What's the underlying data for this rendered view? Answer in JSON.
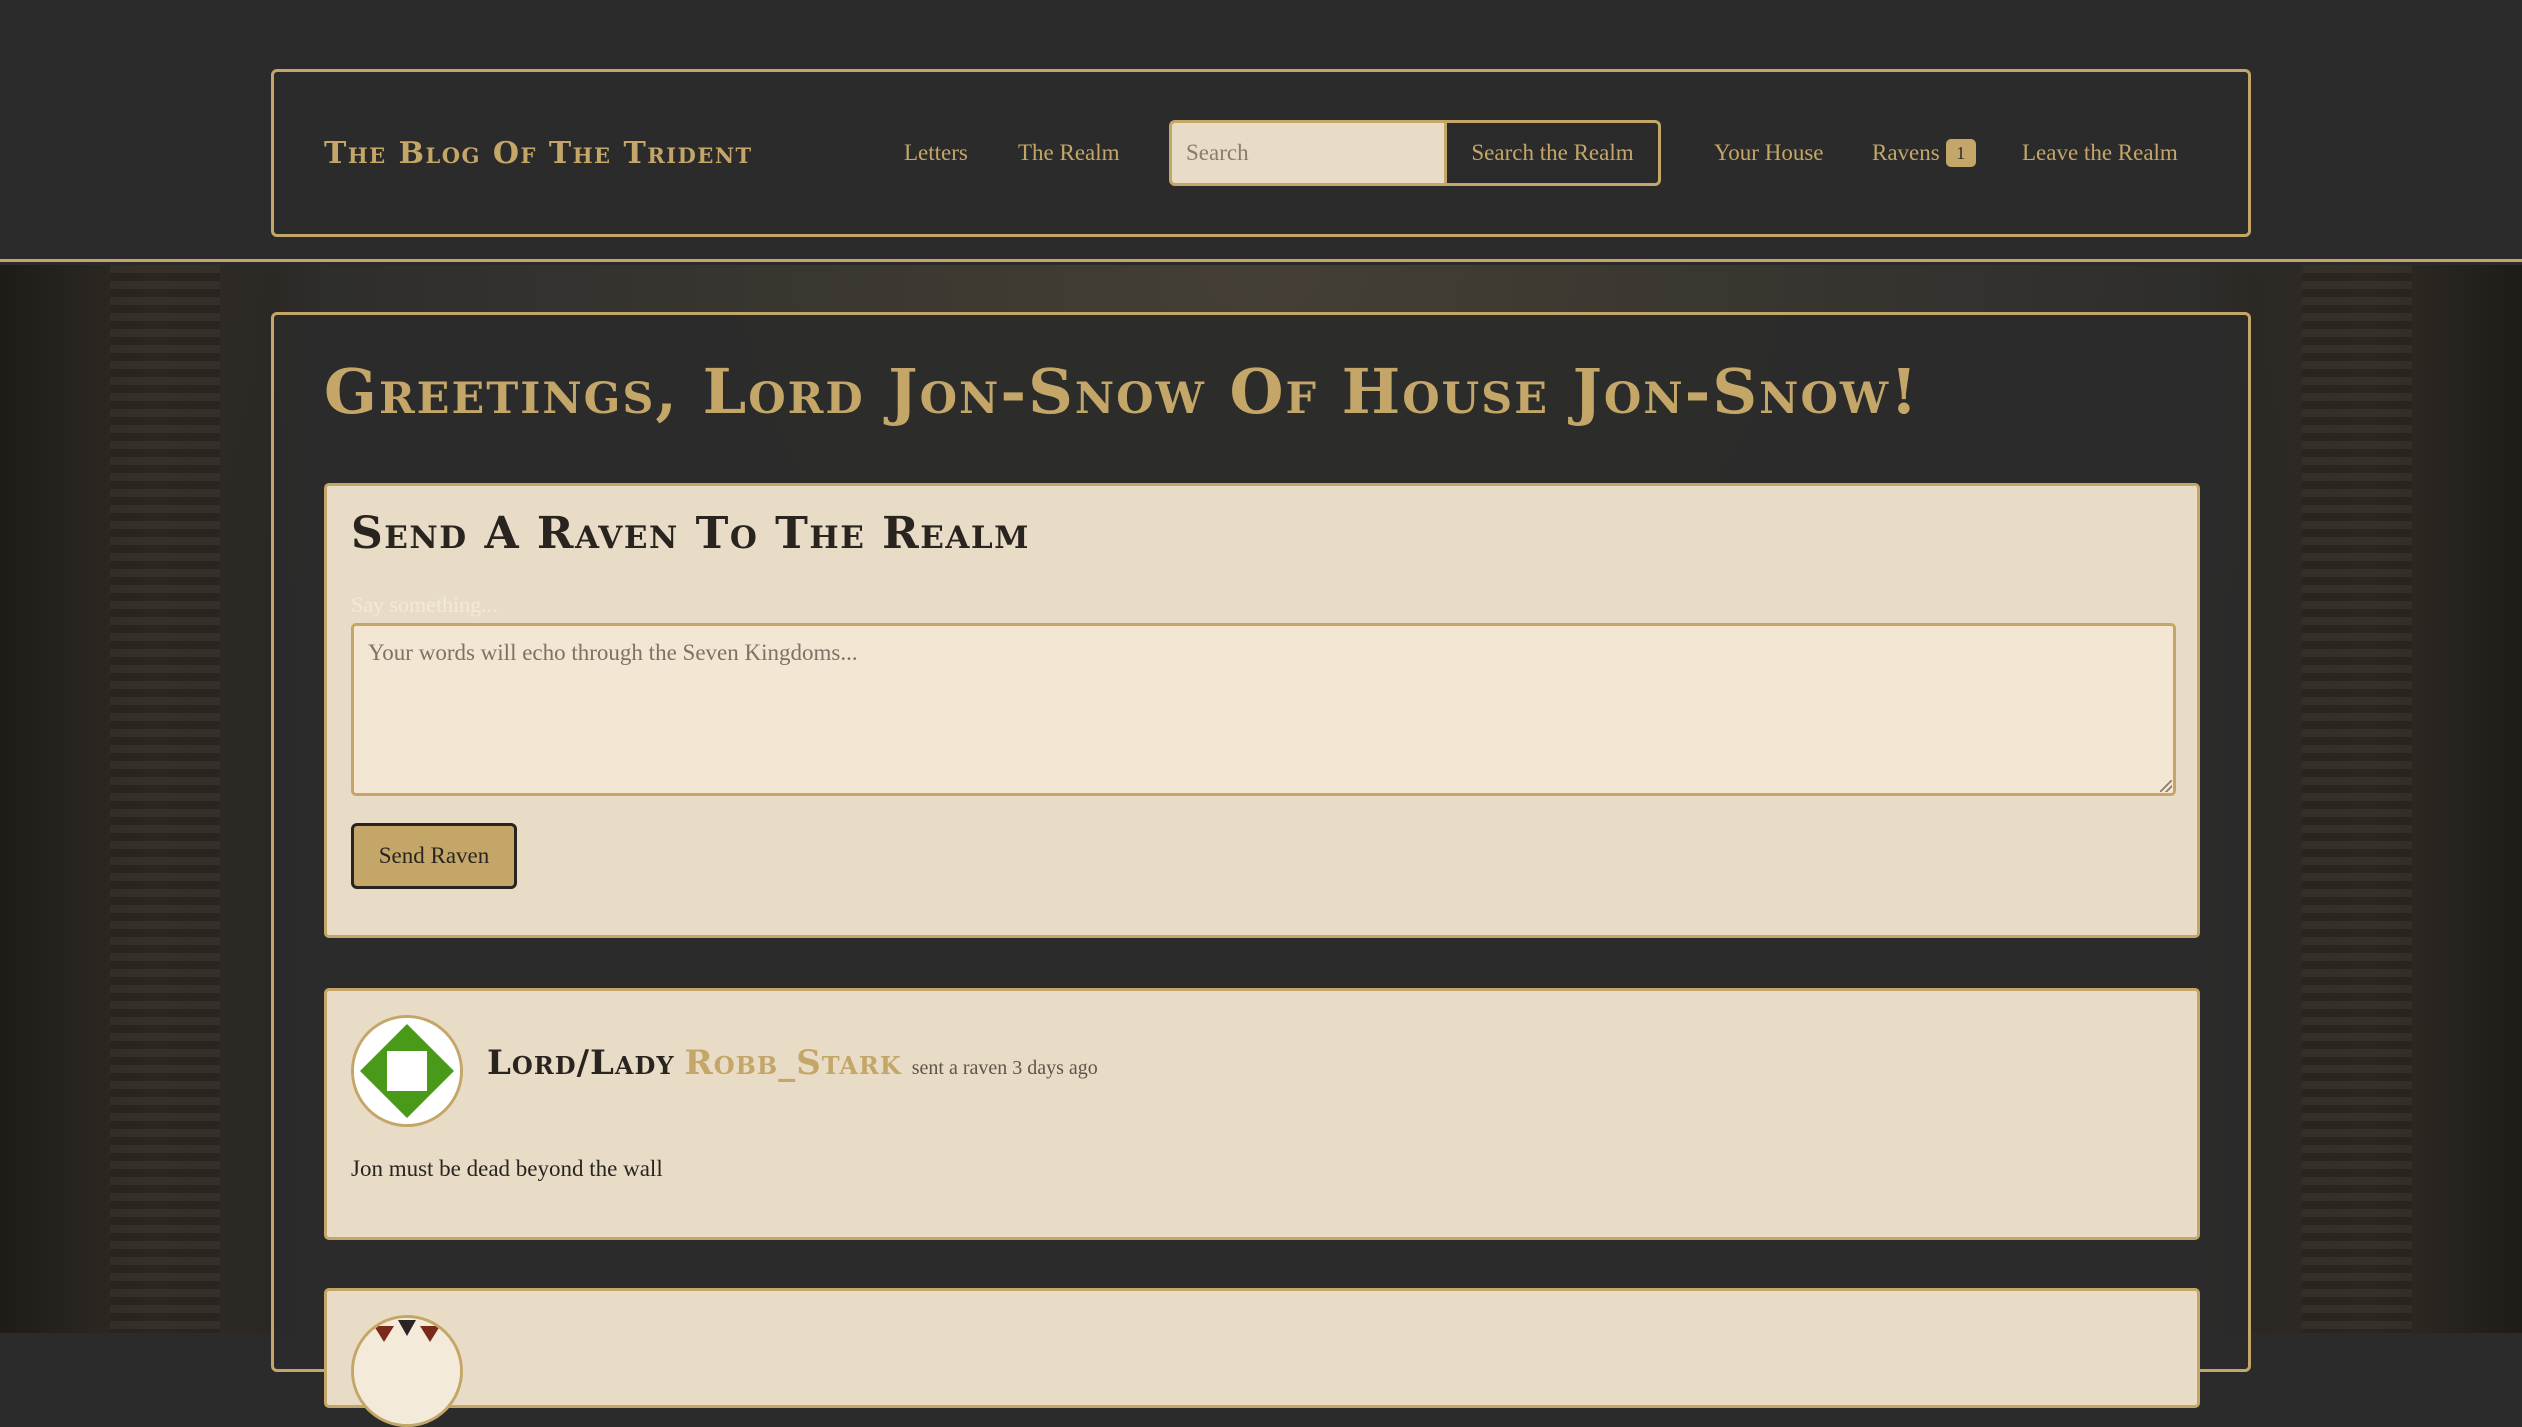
{
  "header": {
    "brand": "The Blog Of The Trident",
    "nav": {
      "letters": "Letters",
      "realm": "The Realm",
      "your_house": "Your House",
      "ravens": "Ravens",
      "ravens_count": "1",
      "leave": "Leave the Realm"
    },
    "search": {
      "placeholder": "Search",
      "button": "Search the Realm"
    }
  },
  "main": {
    "greeting": "Greetings, Lord Jon-Snow Of House Jon-Snow!",
    "compose": {
      "title": "Send A Raven To The Realm",
      "label": "Say something...",
      "placeholder": "Your words will echo through the Seven Kingdoms...",
      "send_button": "Send Raven"
    },
    "posts": [
      {
        "prefix": "Lord/Lady",
        "author": "Robb_Stark",
        "meta": "sent a raven 3 days ago",
        "body": "Jon must be dead beyond the wall",
        "avatar_colors": [
          "#4a9a1a",
          "#ffffff"
        ]
      }
    ]
  },
  "colors": {
    "gold": "#c4a768",
    "dark": "#2b2b2b",
    "parchment": "#e9dcc7"
  }
}
